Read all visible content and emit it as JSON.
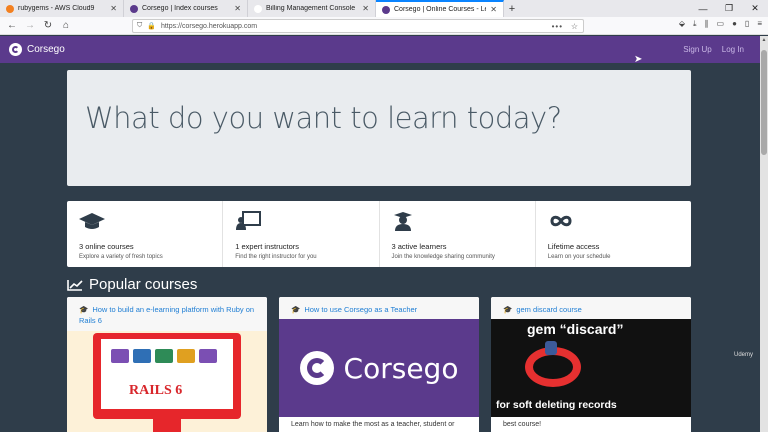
{
  "browser": {
    "tabs": [
      {
        "title": "rubygems - AWS Cloud9",
        "color": "#f38020"
      },
      {
        "title": "Corsego | Index courses",
        "color": "#5b3a8c"
      },
      {
        "title": "Billing Management Console",
        "color": "#ffffff"
      },
      {
        "title": "Corsego | Online Courses - Lea",
        "color": "#5b3a8c"
      }
    ],
    "url": "https://corsego.herokuapp.com",
    "new_tab": "+"
  },
  "app": {
    "brand": "Corsego",
    "nav": {
      "signup": "Sign Up",
      "login": "Log In"
    },
    "hero": "What do you want to learn today?",
    "stats": [
      {
        "title": "3 online courses",
        "sub": "Explore a variety of fresh topics",
        "icon": "graduation-cap-icon"
      },
      {
        "title": "1 expert instructors",
        "sub": "Find the right instructor for you",
        "icon": "chalkboard-teacher-icon"
      },
      {
        "title": "3 active learners",
        "sub": "Join the knowledge sharing community",
        "icon": "user-graduate-icon"
      },
      {
        "title": "Lifetime access",
        "sub": "Learn on your schedule",
        "icon": "infinity-icon"
      }
    ],
    "popular_heading": "Popular courses",
    "courses": [
      {
        "title": "How to build an e-learning platform with Ruby on Rails 6",
        "image_text": "RAILS 6"
      },
      {
        "title": "How to use Corsego as a Teacher",
        "image_text": "Corsego",
        "desc": "Learn how to make the most as a teacher, student or"
      },
      {
        "title": "gem discard course",
        "image_top": "gem “discard”",
        "image_bottom": "for soft deleting records",
        "desc": "best course!"
      }
    ]
  },
  "watermark": "Udemy"
}
